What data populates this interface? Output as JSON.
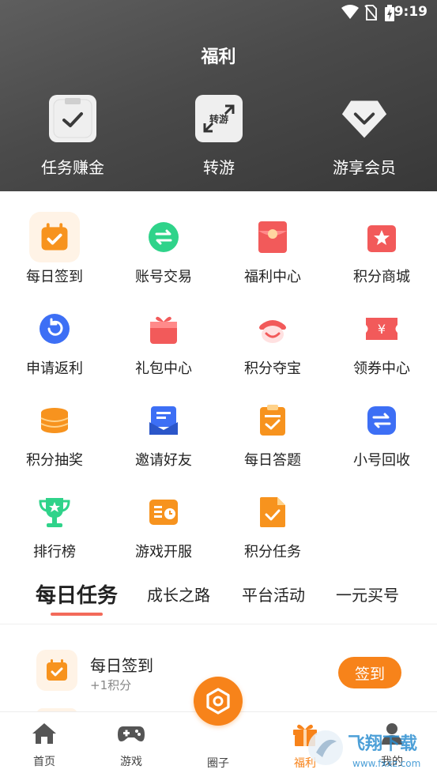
{
  "status_bar": {
    "time": "9:19"
  },
  "header": {
    "title": "福利",
    "quick_actions": [
      {
        "label": "任务赚金",
        "icon": "clipboard-check-icon"
      },
      {
        "label": "转游",
        "icon": "transfer-game-icon",
        "tile_text": "转游"
      },
      {
        "label": "游享会员",
        "icon": "vip-diamond-icon"
      }
    ]
  },
  "grid": [
    {
      "label": "每日签到",
      "icon": "calendar-check-icon",
      "color": "#f7931e"
    },
    {
      "label": "账号交易",
      "icon": "exchange-icon",
      "color": "#2fd38a"
    },
    {
      "label": "福利中心",
      "icon": "red-envelope-icon",
      "color": "#f25a5a"
    },
    {
      "label": "积分商城",
      "icon": "shopping-bag-icon",
      "color": "#f25a5a"
    },
    {
      "label": "申请返利",
      "icon": "rebate-icon",
      "color": "#3d6ff5"
    },
    {
      "label": "礼包中心",
      "icon": "gift-icon",
      "color": "#f25a5a"
    },
    {
      "label": "积分夺宝",
      "icon": "treasure-icon",
      "color": "#f25a5a"
    },
    {
      "label": "领券中心",
      "icon": "coupon-icon",
      "color": "#f25a5a"
    },
    {
      "label": "积分抽奖",
      "icon": "coin-stack-icon",
      "color": "#f7931e"
    },
    {
      "label": "邀请好友",
      "icon": "invite-mail-icon",
      "color": "#3d6ff5"
    },
    {
      "label": "每日答题",
      "icon": "quiz-clipboard-icon",
      "color": "#f7931e"
    },
    {
      "label": "小号回收",
      "icon": "recycle-icon",
      "color": "#3d6ff5"
    },
    {
      "label": "排行榜",
      "icon": "trophy-icon",
      "color": "#2fd38a"
    },
    {
      "label": "游戏开服",
      "icon": "server-clock-icon",
      "color": "#f7931e"
    },
    {
      "label": "积分任务",
      "icon": "task-document-icon",
      "color": "#f7931e"
    }
  ],
  "tabs": [
    {
      "label": "每日任务",
      "active": true
    },
    {
      "label": "成长之路",
      "active": false
    },
    {
      "label": "平台活动",
      "active": false
    },
    {
      "label": "一元买号",
      "active": false
    }
  ],
  "task": {
    "title": "每日签到",
    "reward": "+1积分",
    "button": "签到"
  },
  "bottom_nav": [
    {
      "label": "首页",
      "icon": "home-icon"
    },
    {
      "label": "游戏",
      "icon": "gamepad-icon"
    },
    {
      "label": "圈子",
      "icon": "circle-hexagon-icon"
    },
    {
      "label": "福利",
      "icon": "gift-box-icon",
      "active": true
    },
    {
      "label": "我的",
      "icon": "user-icon"
    }
  ],
  "colors": {
    "accent": "#f7831a",
    "tab_underline": "#f36a5a",
    "header_bg": "#4a4a4a"
  },
  "watermark": {
    "brand": "飞翔下载",
    "url": "www.fxxz.com"
  }
}
